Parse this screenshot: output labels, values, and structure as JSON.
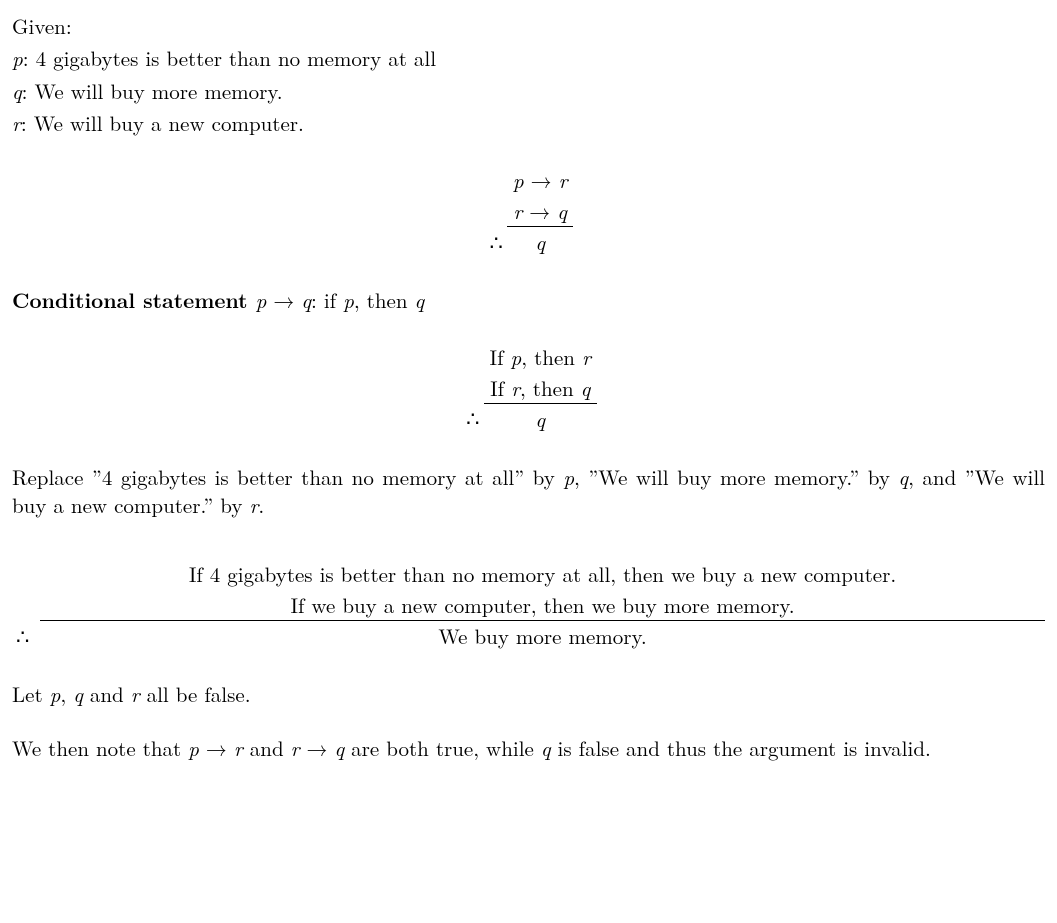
{
  "given_label": "Given:",
  "propositions": {
    "p": {
      "var": "p",
      "text": "4 gigabytes is better than no memory at all"
    },
    "q": {
      "var": "q",
      "text": "We will buy more memory."
    },
    "r": {
      "var": "r",
      "text": "We will buy a new computer."
    }
  },
  "symbolic_argument": {
    "premise1_lhs": "p",
    "premise1_rhs": "r",
    "premise2_lhs": "r",
    "premise2_rhs": "q",
    "therefore": "∴",
    "conclusion": "q"
  },
  "conditional_def": {
    "label": "Conditional statement ",
    "expr_lhs": "p",
    "expr_rhs": "q",
    "def_text": ": if ",
    "p": "p",
    "comma_then": ", then ",
    "q": "q"
  },
  "verbal_argument": {
    "p1_prefix": "If ",
    "p1_var1": "p",
    "p1_mid": ", then ",
    "p1_var2": "r",
    "p2_prefix": "If ",
    "p2_var1": "r",
    "p2_mid": ", then ",
    "p2_var2": "q",
    "therefore": "∴",
    "conclusion_var": "q"
  },
  "replace_para": {
    "t1": "Replace ”4 gigabytes is better than no memory at all” by ",
    "v1": "p",
    "t2": ", ”We will buy more memory.” by ",
    "v2": "q",
    "t3": ", and ”We will buy a new computer.” by ",
    "v3": "r",
    "t4": "."
  },
  "full_argument": {
    "p1": "If 4 gigabytes is better than no memory at all, then we buy a new computer.",
    "p2": "If we buy a new computer, then we buy more memory.",
    "therefore": "∴",
    "conclusion": "We buy more memory."
  },
  "let_para": {
    "t1": "Let ",
    "v1": "p",
    "t2": ", ",
    "v2": "q",
    "t3": " and ",
    "v3": "r",
    "t4": " all be false."
  },
  "note_para": {
    "t1": "We then note that ",
    "e1_lhs": "p",
    "e1_rhs": "r",
    "t2": " and ",
    "e2_lhs": "r",
    "e2_rhs": "q",
    "t3": " are both true, while ",
    "v1": "q",
    "t4": " is false and thus the argument is invalid."
  },
  "arrow": "→"
}
